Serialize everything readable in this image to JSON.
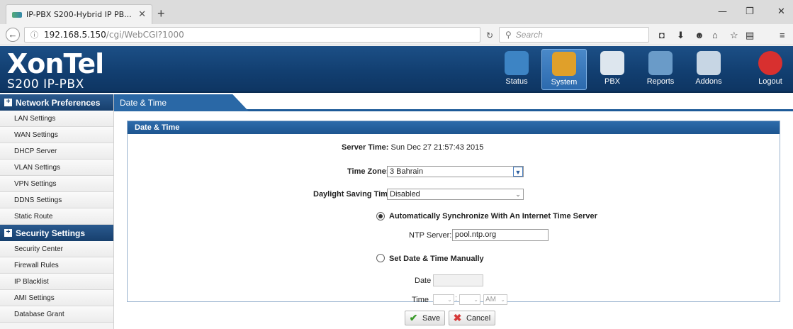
{
  "browser": {
    "tab_title": "IP-PBX S200-Hybrid IP PB...",
    "tab_close": "✕",
    "new_tab": "+",
    "url_host": "192.168.5.150",
    "url_path": "/cgi/WebCGI?1000",
    "search_placeholder": "Search",
    "window_min": "—",
    "window_max": "❐",
    "window_close": "✕"
  },
  "header": {
    "brand": "XonTel",
    "subtitle": "S200 IP-PBX",
    "nav": [
      {
        "label": "Status",
        "color": "#3d84c4"
      },
      {
        "label": "System",
        "color": "#e0a02a"
      },
      {
        "label": "PBX",
        "color": "#dde6ee"
      },
      {
        "label": "Reports",
        "color": "#6a9bc8"
      },
      {
        "label": "Addons",
        "color": "#c7d6e4"
      },
      {
        "label": "Logout",
        "color": "#d8302f"
      }
    ],
    "active": "System"
  },
  "sidebar": {
    "section1": "Network Preferences",
    "items1": [
      "LAN Settings",
      "WAN Settings",
      "DHCP Server",
      "VLAN Settings",
      "VPN Settings",
      "DDNS Settings",
      "Static Route"
    ],
    "section2": "Security Settings",
    "items2": [
      "Security Center",
      "Firewall Rules",
      "IP Blacklist",
      "AMI Settings",
      "Database Grant"
    ]
  },
  "main": {
    "breadcrumb": "Date & Time",
    "panel_title": "Date & Time",
    "server_time_label": "Server Time:",
    "server_time_value": "Sun Dec 27 21:57:43 2015",
    "timezone_label": "Time Zone:",
    "timezone_value": "3 Bahrain",
    "dst_label": "Daylight Saving Time:",
    "dst_value": "Disabled",
    "auto_sync_label": "Automatically Synchronize With An Internet Time Server",
    "ntp_label": "NTP Server:",
    "ntp_value": "pool.ntp.org",
    "manual_label": "Set Date & Time Manually",
    "date_label": "Date",
    "time_label": "Time",
    "ampm_value": "AM",
    "save_label": "Save",
    "cancel_label": "Cancel"
  }
}
